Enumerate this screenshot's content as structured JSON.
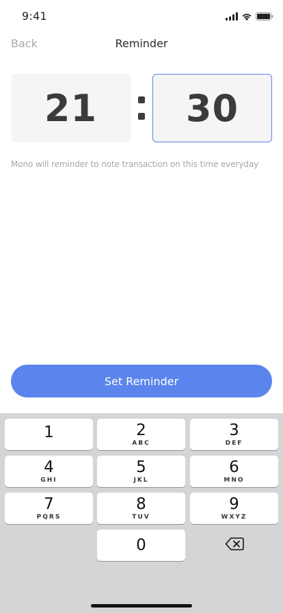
{
  "status_bar": {
    "time": "9:41",
    "icons": [
      "signal-icon",
      "wifi-icon",
      "battery-icon"
    ]
  },
  "header": {
    "back_label": "Back",
    "title": "Reminder"
  },
  "time_picker": {
    "hour": "21",
    "minute": "30",
    "separator": ":"
  },
  "hint_text": "Mono will reminder to note transaction on this time everyday",
  "primary_button": {
    "label": "Set Reminder",
    "color": "#5b85ec"
  },
  "keypad": {
    "keys": [
      {
        "digit": "1",
        "letters": ""
      },
      {
        "digit": "2",
        "letters": "ABC"
      },
      {
        "digit": "3",
        "letters": "DEF"
      },
      {
        "digit": "4",
        "letters": "GHI"
      },
      {
        "digit": "5",
        "letters": "JKL"
      },
      {
        "digit": "6",
        "letters": "MNO"
      },
      {
        "digit": "7",
        "letters": "PQRS"
      },
      {
        "digit": "8",
        "letters": "TUV"
      },
      {
        "digit": "9",
        "letters": "WXYZ"
      },
      {
        "digit": "0",
        "letters": ""
      }
    ],
    "backspace_icon": "backspace-icon"
  },
  "colors": {
    "accent": "#5b85ec",
    "focus_border": "#5b82e8",
    "box_background": "#f5f5f5",
    "muted_text": "#a6a6a6"
  }
}
